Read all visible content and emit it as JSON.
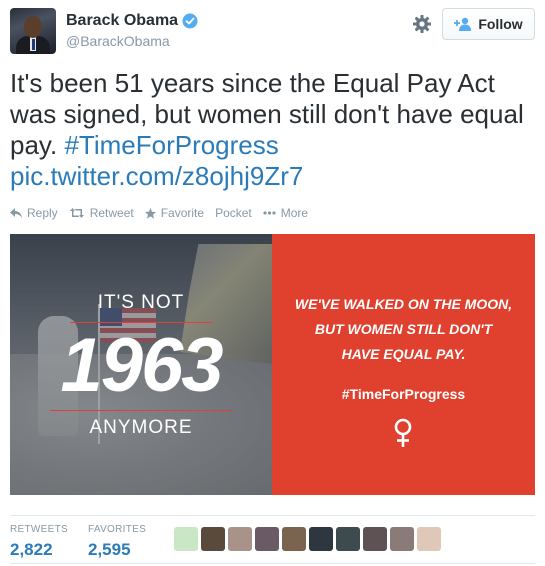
{
  "user": {
    "fullname": "Barack Obama",
    "screenname": "@BarackObama",
    "follow_label": "Follow"
  },
  "tweet": {
    "text_plain": "It's been 51 years since the Equal Pay Act was signed, but women still don't have equal pay.",
    "hashtag": "#TimeForProgress",
    "pic_link": "pic.twitter.com/z8ojhj9Zr7"
  },
  "actions": [
    {
      "label": "Reply",
      "icon": "reply-icon"
    },
    {
      "label": "Retweet",
      "icon": "retweet-icon"
    },
    {
      "label": "Favorite",
      "icon": "star-icon"
    },
    {
      "label": "Pocket",
      "icon": ""
    },
    {
      "label": "More",
      "icon": "more-dots-icon"
    }
  ],
  "media": {
    "left_top": "IT'S NOT",
    "left_year": "1963",
    "left_bottom": "ANYMORE",
    "right_line1": "WE'VE WALKED ON THE MOON,",
    "right_line2": "BUT WOMEN STILL DON'T",
    "right_line3": "HAVE EQUAL PAY.",
    "right_hashtag": "#TimeForProgress"
  },
  "stats": {
    "retweets_label": "RETWEETS",
    "retweets_value": "2,822",
    "favorites_label": "FAVORITES",
    "favorites_value": "2,595"
  },
  "colors": {
    "link": "#2b7bb9",
    "accent_red": "#e0402e",
    "muted": "#8899a6",
    "verified": "#55acee"
  },
  "favoriter_thumbs": [
    "#c9e7c4",
    "#5a4a3c",
    "#a8928a",
    "#6a5a66",
    "#7a6450",
    "#2e3640",
    "#3d4a4e",
    "#5e5254",
    "#8a7a78",
    "#e0c8b8"
  ]
}
